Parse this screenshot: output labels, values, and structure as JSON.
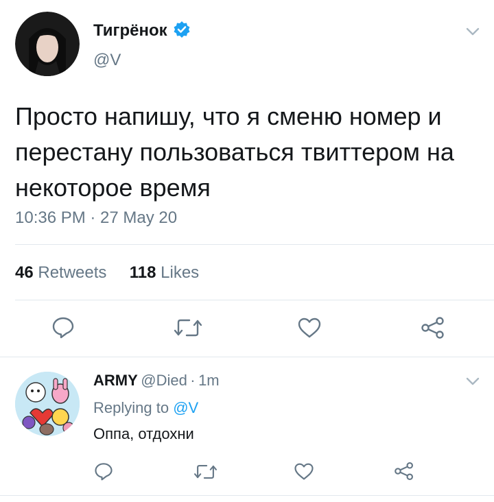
{
  "tweet": {
    "author_name": "Тигрёнок",
    "author_handle": "@V",
    "text": "Просто напишу, что я сменю номер и перестану пользоваться твиттером на некоторое время",
    "timestamp": "10:36 PM · 27 May 20",
    "retweets_count": "46",
    "retweets_label": "Retweets",
    "likes_count": "118",
    "likes_label": "Likes",
    "verified_icon": "verified-badge-icon"
  },
  "reply": {
    "author_name": "ARMY",
    "author_handle": "@Died",
    "separator": "·",
    "time_ago": "1m",
    "replying_prefix": "Replying to",
    "replying_handle": "@V",
    "text": "Оппа, отдохни"
  },
  "icons": {
    "reply": "reply-icon",
    "retweet": "retweet-icon",
    "like": "heart-icon",
    "share": "share-icon",
    "menu": "chevron-down-icon"
  },
  "colors": {
    "accent": "#1da1f2",
    "icon": "#657786",
    "divider": "#e1e8ed"
  }
}
